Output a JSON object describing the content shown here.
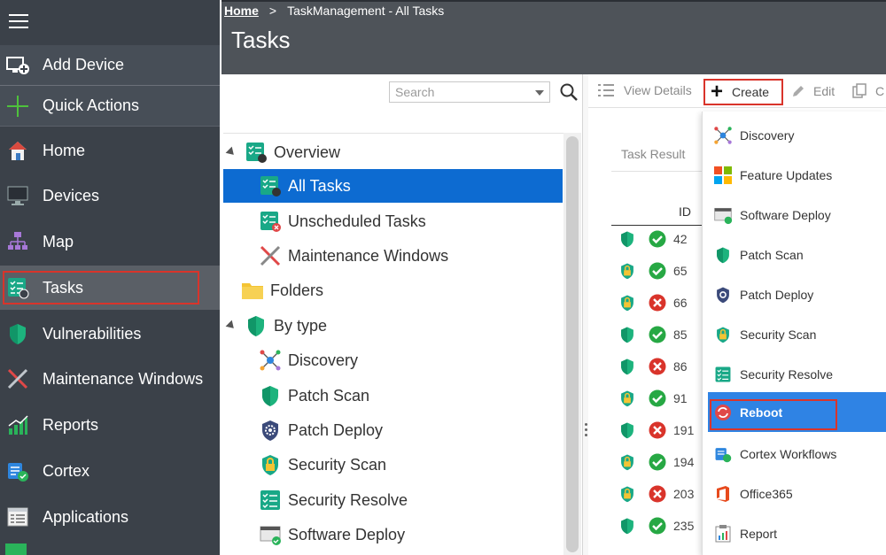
{
  "breadcrumb": {
    "home": "Home",
    "separator": ">",
    "current": "TaskManagement - All Tasks"
  },
  "page_title": "Tasks",
  "sidebar": {
    "menu_icon": "hamburger-icon",
    "items": [
      {
        "label": "Add Device",
        "icon": "add-device-icon"
      },
      {
        "label": "Quick Actions",
        "icon": "plus-icon"
      },
      {
        "label": "Home",
        "icon": "home-icon"
      },
      {
        "label": "Devices",
        "icon": "monitor-icon"
      },
      {
        "label": "Map",
        "icon": "network-map-icon"
      },
      {
        "label": "Tasks",
        "icon": "tasks-icon",
        "active": true
      },
      {
        "label": "Vulnerabilities",
        "icon": "shield-icon"
      },
      {
        "label": "Maintenance Windows",
        "icon": "tools-icon"
      },
      {
        "label": "Reports",
        "icon": "bar-chart-icon"
      },
      {
        "label": "Cortex",
        "icon": "cortex-icon"
      },
      {
        "label": "Applications",
        "icon": "applications-icon"
      }
    ]
  },
  "search": {
    "placeholder": "Search",
    "value": ""
  },
  "tree": {
    "overview": "Overview",
    "all_tasks": "All Tasks",
    "unscheduled": "Unscheduled Tasks",
    "maintenance": "Maintenance Windows",
    "folders": "Folders",
    "by_type": "By type",
    "types": [
      "Discovery",
      "Patch Scan",
      "Patch Deploy",
      "Security Scan",
      "Security Resolve",
      "Software Deploy"
    ]
  },
  "toolbar": {
    "view_details": "View Details",
    "create": "Create",
    "edit": "Edit",
    "copy": "C"
  },
  "grid": {
    "tab_label": "Task Result",
    "id_header": "ID",
    "rows": [
      {
        "id": "42",
        "status": "ok",
        "shield": "plain"
      },
      {
        "id": "65",
        "status": "ok",
        "shield": "lock"
      },
      {
        "id": "66",
        "status": "fail",
        "shield": "lock"
      },
      {
        "id": "85",
        "status": "ok",
        "shield": "plain"
      },
      {
        "id": "86",
        "status": "fail",
        "shield": "plain"
      },
      {
        "id": "91",
        "status": "ok",
        "shield": "lock"
      },
      {
        "id": "191",
        "status": "fail",
        "shield": "plain"
      },
      {
        "id": "194",
        "status": "ok",
        "shield": "lock"
      },
      {
        "id": "203",
        "status": "fail",
        "shield": "lock"
      },
      {
        "id": "235",
        "status": "ok",
        "shield": "plain"
      }
    ]
  },
  "create_menu": {
    "items": [
      {
        "label": "Discovery",
        "icon": "discovery-icon"
      },
      {
        "label": "Feature Updates",
        "icon": "windows-icon"
      },
      {
        "label": "Software Deploy",
        "icon": "software-deploy-icon"
      },
      {
        "label": "Patch Scan",
        "icon": "shield-icon"
      },
      {
        "label": "Patch Deploy",
        "icon": "gear-shield-icon"
      },
      {
        "label": "Security Scan",
        "icon": "lock-shield-icon"
      },
      {
        "label": "Security Resolve",
        "icon": "checklist-icon"
      },
      {
        "label": "Reboot",
        "icon": "reboot-icon",
        "selected": true
      },
      {
        "label": "Cortex Workflows",
        "icon": "cortex-icon"
      },
      {
        "label": "Office365",
        "icon": "office-icon"
      },
      {
        "label": "Report",
        "icon": "report-icon"
      }
    ]
  },
  "colors": {
    "sidebar_bg": "#3b4149",
    "header_bg": "#4e5359",
    "selection_blue": "#0d6bd1",
    "menu_selection": "#2f83e4",
    "highlight_red": "#d9342b",
    "ok_green": "#27a844",
    "fail_red": "#d9342b",
    "shield_teal": "#12a87a"
  }
}
